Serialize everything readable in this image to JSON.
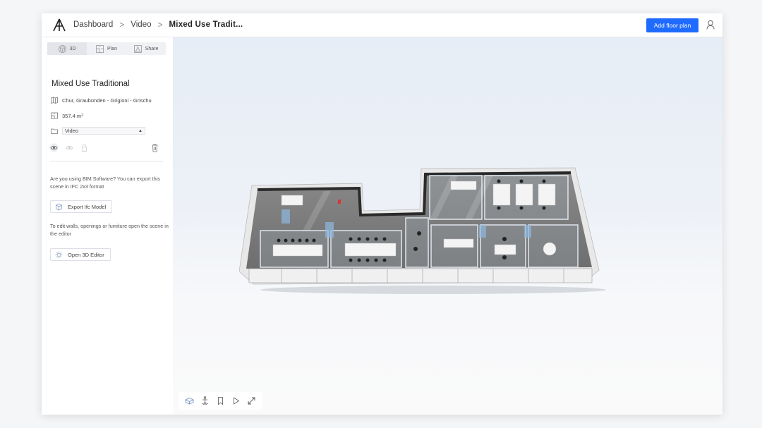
{
  "header": {
    "logo_icon": "archilogic-logo-icon",
    "breadcrumbs": [
      "Dashboard",
      "Video"
    ],
    "current": "Mixed Use Tradit...",
    "add_button": "Add floor plan",
    "user_icon": "user-icon"
  },
  "sidebar": {
    "tabs": [
      {
        "label": "3D",
        "icon": "cube-icon",
        "active": true
      },
      {
        "label": "Plan",
        "icon": "floorplan-icon",
        "active": false
      },
      {
        "label": "Share",
        "icon": "share-icon",
        "active": false
      }
    ],
    "title": "Mixed Use Traditional",
    "location": "Chur, Graubünden - Grigioni - Grischu",
    "area_value": "357.4 m",
    "area_sup": "2",
    "folder": "Video",
    "export_text": "Are you using BIM Software? You can export this scene in IFC 2x3 format",
    "export_button": "Export Ifc Model",
    "editor_text": "To edit walls, openings or furniture open the scene in the editor",
    "editor_button": "Open 3D Editor"
  },
  "toolbar": {
    "items": [
      "view-mode-icon",
      "person-icon",
      "bookmark-icon",
      "play-icon",
      "fullscreen-icon"
    ]
  },
  "colors": {
    "accent": "#1f6bff",
    "header_bg": "#ffffff",
    "viewport_sky": "#e6edf6"
  }
}
